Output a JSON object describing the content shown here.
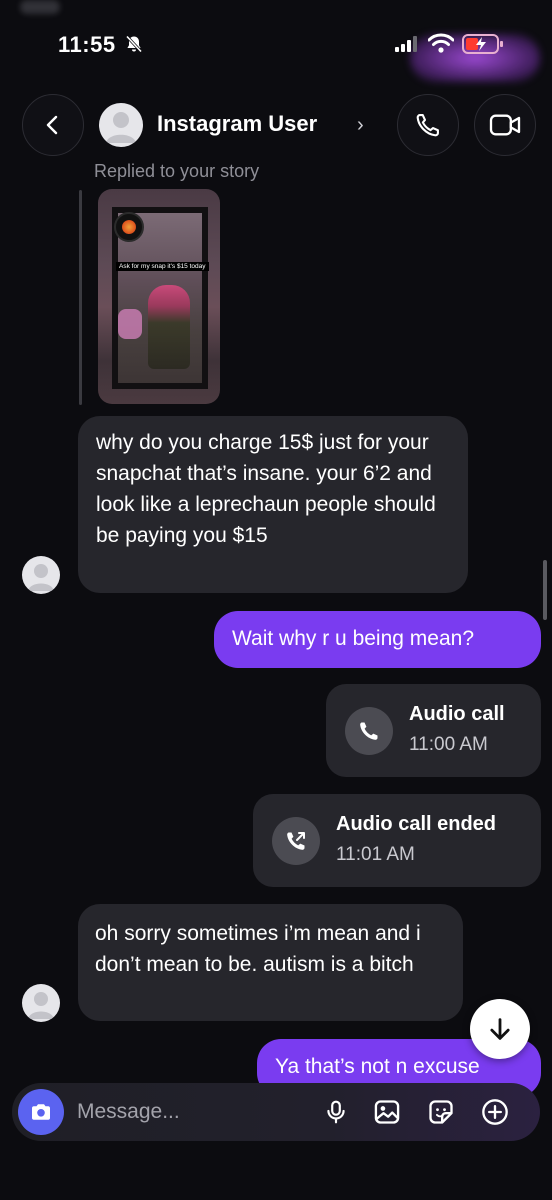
{
  "status_bar": {
    "time": "11:55"
  },
  "header": {
    "name": "Instagram User",
    "chevron": "›",
    "icons": [
      "back-chevron-icon",
      "phone-icon",
      "video-camera-icon"
    ]
  },
  "reply": {
    "label": "Replied to your story",
    "story_caption": "Ask for my snap it's $15 today"
  },
  "messages": [
    {
      "side": "in",
      "text": "why do you charge 15$ just for your snapchat that’s insane. your 6’2 and look like a leprechaun people should be paying you $15"
    },
    {
      "side": "out",
      "text": "Wait why r u being mean?"
    },
    {
      "side": "call",
      "title": "Audio call",
      "time": "11:00 AM"
    },
    {
      "side": "call",
      "title": "Audio call ended",
      "time": "11:01 AM"
    },
    {
      "side": "in",
      "text": "oh sorry sometimes i’m mean and i don’t mean to be. autism is a bitch"
    },
    {
      "side": "out",
      "text": "Ya that’s not n excuse"
    }
  ],
  "composer": {
    "placeholder": "Message...",
    "icons": [
      "camera-icon",
      "microphone-icon",
      "gallery-icon",
      "sticker-icon",
      "plus-icon"
    ]
  },
  "colors": {
    "background": "#0c0c10",
    "incoming_bubble": "#26262c",
    "outgoing_bubble": "#7a3cf0",
    "camera_button": "#5b63f0"
  }
}
